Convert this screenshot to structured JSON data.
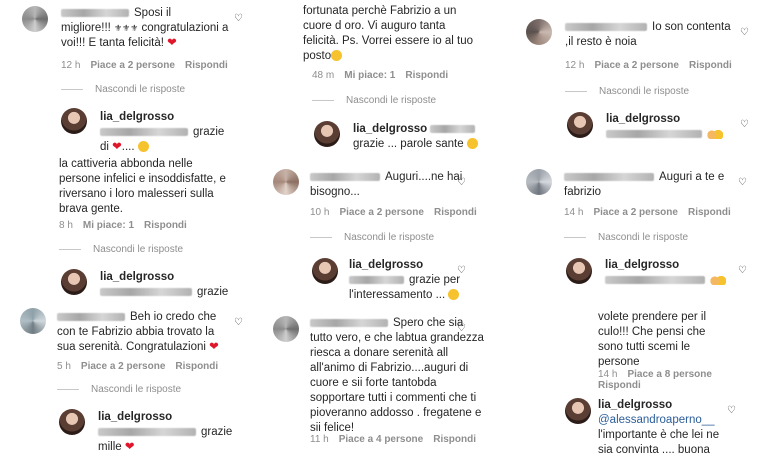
{
  "common": {
    "reply_label": "Rispondi",
    "hide_replies": "Nascondi le risposte",
    "heart_glyph": "♡"
  },
  "c1": {
    "text_line1": "Sposi il",
    "text_line2": "migliore!!!",
    "text_line3": "congratulazioni a",
    "text_line4": "voi!!! E tanta felicità!",
    "time": "12 h",
    "likes": "Piace a 2 persone"
  },
  "c1_reply": {
    "username": "lia_delgrosso",
    "text_line1": "grazie",
    "text_line2": "di"
  },
  "c2": {
    "text_line1": "fortunata perchè Fabrizio a un",
    "text_line2": "cuore d oro. Vi auguro tanta",
    "text_line3": "felicità. Ps. Vorrei essere io al tuo",
    "text_line4": "posto",
    "time": "48 m",
    "likes": "Mi piace: 1"
  },
  "c2_reply": {
    "username": "lia_delgrosso",
    "text_line2": "grazie ... parole sante"
  },
  "c3": {
    "text_line1": "Io son contenta",
    "text_line2": ",il resto è noia",
    "time": "12 h",
    "likes": "Piace a 2 persone"
  },
  "c3_reply": {
    "username": "lia_delgrosso"
  },
  "c4": {
    "text_line1": "la cattiveria abbonda nelle",
    "text_line2": "persone infelici e insoddisfatte, e",
    "text_line3": "riversano i loro malesseri sulla",
    "text_line4": "brava gente.",
    "time": "8 h",
    "likes": "Mi piace: 1"
  },
  "c4_reply": {
    "username": "lia_delgrosso",
    "text_line2": "grazie"
  },
  "c5": {
    "text_line1": "Auguri....ne hai",
    "text_line2": "bisogno...",
    "time": "10 h",
    "likes": "Piace a 2 persone"
  },
  "c5_reply": {
    "username": "lia_delgrosso",
    "text_line1": "grazie per",
    "text_line2": "l'interessamento ..."
  },
  "c6": {
    "text_line1": "Auguri a te e",
    "text_line2": "fabrizio",
    "time": "14 h",
    "likes": "Piace a 2 persone"
  },
  "c6_reply": {
    "username": "lia_delgrosso"
  },
  "c7": {
    "text_line1": "Beh io credo che",
    "text_line2": "con te Fabrizio abbia trovato la",
    "text_line3": "sua serenità. Congratulazioni",
    "time": "5 h",
    "likes": "Piace a 2 persone"
  },
  "c7_reply": {
    "username": "lia_delgrosso",
    "text_line1": "grazie",
    "text_line2": "mille"
  },
  "c8": {
    "text_line1": "Spero che sia",
    "text_line2": "tutto vero, e che labtua grandezza",
    "text_line3": "riesca a donare serenità all",
    "text_line4": "all'animo di Fabrizio....auguri di",
    "text_line5": "cuore e sii forte tantobda",
    "text_line6": "sopportare tutti i commenti che ti",
    "text_line7": "pioveranno addosso . fregatene e",
    "text_line8": "sii felice!",
    "time": "11 h",
    "likes": "Piace a 4 persone"
  },
  "c9": {
    "text_line1": "volete prendere per il",
    "text_line2": "culo!!! Che pensi che",
    "text_line3": "sono tutti scemi le",
    "text_line4": "persone",
    "time": "14 h",
    "likes": "Piace a 8 persone"
  },
  "c9_reply": {
    "username": "lia_delgrosso",
    "mention": "@alessandroaperno__",
    "text_line2": "l'importante è che lei ne",
    "text_line3": "sia convinta .... buona"
  }
}
